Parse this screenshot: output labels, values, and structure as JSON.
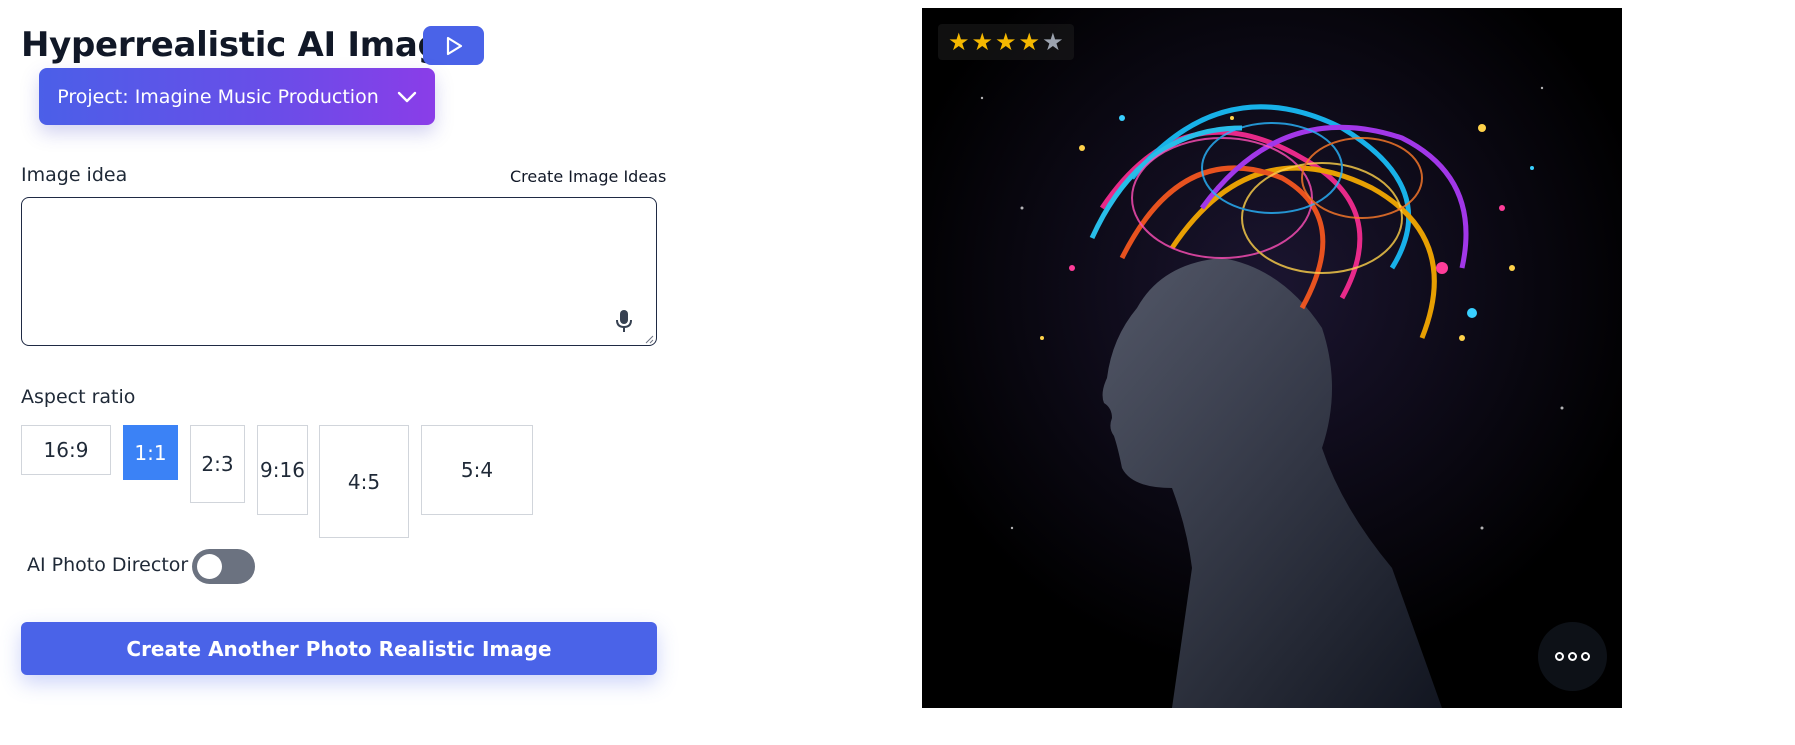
{
  "header": {
    "title": "Hyperrealistic AI Images",
    "play_icon": "play-icon"
  },
  "project": {
    "label": "Project: Imagine Music Production",
    "icon": "chevron-down-icon"
  },
  "image_idea": {
    "label": "Image idea",
    "create_ideas_link": "Create Image Ideas",
    "value": "",
    "mic_icon": "microphone-icon"
  },
  "aspect_ratio": {
    "label": "Aspect ratio",
    "options": [
      "16:9",
      "1:1",
      "2:3",
      "9:16",
      "4:5",
      "5:4"
    ],
    "selected": "1:1"
  },
  "photo_director": {
    "label": "AI Photo Director",
    "enabled": false
  },
  "create_button": {
    "label": "Create Another Photo Realistic Image"
  },
  "preview": {
    "rating": 4,
    "rating_max": 5,
    "star_filled_color": "#f5b800",
    "star_empty_color": "#9ca3af",
    "more_icon": "more-options-icon"
  },
  "colors": {
    "accent": "#4a63e8",
    "selected_ratio": "#3b82f6",
    "toggle_off": "#6b7280"
  }
}
